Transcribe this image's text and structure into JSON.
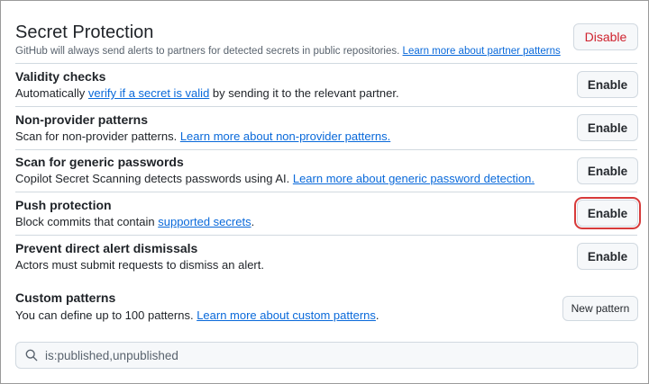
{
  "header": {
    "title": "Secret Protection",
    "description": "GitHub will always send alerts to partners for detected secrets in public repositories.",
    "description_link": "Learn more about partner patterns",
    "disable_label": "Disable"
  },
  "rows": [
    {
      "title": "Validity checks",
      "desc_before": "Automatically ",
      "link": "verify if a secret is valid",
      "desc_after": " by sending it to the relevant partner.",
      "button": "Enable"
    },
    {
      "title": "Non-provider patterns",
      "desc_before": "Scan for non-provider patterns. ",
      "link": "Learn more about non-provider patterns.",
      "desc_after": "",
      "button": "Enable"
    },
    {
      "title": "Scan for generic passwords",
      "desc_before": "Copilot Secret Scanning detects passwords using AI. ",
      "link": "Learn more about generic password detection.",
      "desc_after": "",
      "button": "Enable"
    },
    {
      "title": "Push protection",
      "desc_before": "Block commits that contain ",
      "link": "supported secrets",
      "desc_after": ".",
      "button": "Enable"
    },
    {
      "title": "Prevent direct alert dismissals",
      "desc_before": "Actors must submit requests to dismiss an alert.",
      "link": "",
      "desc_after": "",
      "button": "Enable"
    }
  ],
  "custom_patterns": {
    "title": "Custom patterns",
    "desc_before": "You can define up to 100 patterns. ",
    "link": "Learn more about custom patterns",
    "desc_after": ".",
    "button": "New pattern"
  },
  "search": {
    "value": "is:published,unpublished",
    "icon": "search-icon"
  }
}
